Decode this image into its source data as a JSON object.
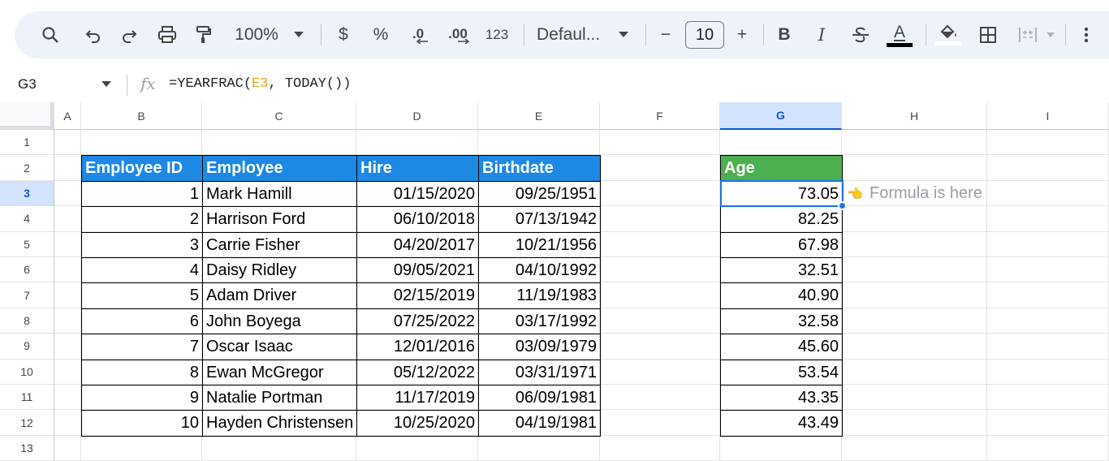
{
  "toolbar": {
    "zoom": "100%",
    "currency": "$",
    "percent": "%",
    "dec_decrease": ".0",
    "dec_increase": ".00",
    "format_number": "123",
    "font": "Defaul...",
    "font_size": "10",
    "minus": "−",
    "plus": "+",
    "bold": "B",
    "italic": "I",
    "text_color": "A"
  },
  "formula_bar": {
    "cell_ref": "G3",
    "fx": "fx",
    "formula_prefix": "=YEARFRAC(",
    "formula_ref": "E3",
    "formula_suffix": ", TODAY())"
  },
  "columns": [
    "A",
    "B",
    "C",
    "D",
    "E",
    "F",
    "G",
    "H",
    "I"
  ],
  "rows": [
    "1",
    "2",
    "3",
    "4",
    "5",
    "6",
    "7",
    "8",
    "9",
    "10",
    "11",
    "12",
    "13"
  ],
  "table": {
    "headers": [
      "Employee ID",
      "Employee",
      "Hire",
      "Birthdate"
    ],
    "rows": [
      [
        "1",
        "Mark Hamill",
        "01/15/2020",
        "09/25/1951"
      ],
      [
        "2",
        "Harrison Ford",
        "06/10/2018",
        "07/13/1942"
      ],
      [
        "3",
        "Carrie Fisher",
        "04/20/2017",
        "10/21/1956"
      ],
      [
        "4",
        "Daisy Ridley",
        "09/05/2021",
        "04/10/1992"
      ],
      [
        "5",
        "Adam Driver",
        "02/15/2019",
        "11/19/1983"
      ],
      [
        "6",
        "John Boyega",
        "07/25/2022",
        "03/17/1992"
      ],
      [
        "7",
        "Oscar Isaac",
        "12/01/2016",
        "03/09/1979"
      ],
      [
        "8",
        "Ewan McGregor",
        "05/12/2022",
        "03/31/1971"
      ],
      [
        "9",
        "Natalie Portman",
        "11/17/2019",
        "06/09/1981"
      ],
      [
        "10",
        "Hayden Christensen",
        "10/25/2020",
        "04/19/1981"
      ]
    ]
  },
  "age": {
    "header": "Age",
    "values": [
      "73.05",
      "82.25",
      "67.98",
      "32.51",
      "40.90",
      "32.58",
      "45.60",
      "53.54",
      "43.35",
      "43.49"
    ]
  },
  "note": "Formula is here",
  "colors": {
    "header_blue": "#1e88e5",
    "header_green": "#4caf50",
    "selection": "#1a73e8"
  }
}
